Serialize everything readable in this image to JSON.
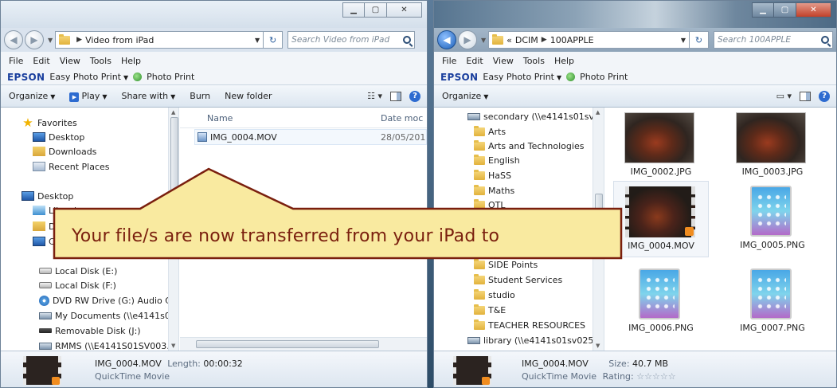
{
  "left_window": {
    "address": {
      "folder": "Video from iPad"
    },
    "search_placeholder": "Search Video from iPad",
    "menu": [
      "File",
      "Edit",
      "View",
      "Tools",
      "Help"
    ],
    "epson": {
      "brand": "EPSON",
      "easy_print": "Easy Photo Print",
      "photo_print": "Photo Print"
    },
    "toolbar": {
      "organize": "Organize",
      "play": "Play",
      "share": "Share with",
      "burn": "Burn",
      "new_folder": "New folder"
    },
    "nav": {
      "favorites": "Favorites",
      "desktop": "Desktop",
      "downloads": "Downloads",
      "recent": "Recent Places",
      "desktop2": "Desktop",
      "libraries": "Libraries",
      "d_partial": "D",
      "c_partial": "C",
      "local_e": "Local Disk (E:)",
      "local_f": "Local Disk (F:)",
      "dvd": "DVD RW Drive (G:) Audio CD",
      "mydocs": "My Documents (\\\\e4141s01sv",
      "removable": "Removable Disk (J:)",
      "rmms": "RMMS (\\\\E4141S01SV003.blue"
    },
    "columns": {
      "name": "Name",
      "date": "Date moc"
    },
    "file": {
      "name": "IMG_0004.MOV",
      "date": "28/05/201"
    },
    "details": {
      "name": "IMG_0004.MOV",
      "length_label": "Length:",
      "length": "00:00:32",
      "type": "QuickTime Movie"
    }
  },
  "right_window": {
    "address": {
      "prefix": "«",
      "parent": "DCIM",
      "folder": "100APPLE"
    },
    "search_placeholder": "Search 100APPLE",
    "menu": [
      "File",
      "Edit",
      "View",
      "Tools",
      "Help"
    ],
    "epson": {
      "brand": "EPSON",
      "easy_print": "Easy Photo Print",
      "photo_print": "Photo Print"
    },
    "toolbar": {
      "organize": "Organize"
    },
    "nav": {
      "secondary": "secondary (\\\\e4141s01sv028.b",
      "folders": [
        "Arts",
        "Arts and Technologies",
        "English",
        "HaSS",
        "Maths",
        "OTL"
      ],
      "side_points": "SIDE Points",
      "folders2": [
        "Student Services",
        "studio",
        "T&E",
        "TEACHER RESOURCES"
      ],
      "library": "library (\\\\e4141s01sv025.blue."
    },
    "tiles": [
      "IMG_0002.JPG",
      "IMG_0003.JPG",
      "IMG_0004.MOV",
      "IMG_0005.PNG",
      "IMG_0006.PNG",
      "IMG_0007.PNG"
    ],
    "details": {
      "name": "IMG_0004.MOV",
      "size_label": "Size:",
      "size": "40.7 MB",
      "type": "QuickTime Movie",
      "rating_label": "Rating:",
      "stars": "☆☆☆☆☆"
    }
  },
  "callout": {
    "text": "Your file/s are now transferred from your iPad to"
  },
  "colors": {
    "callout_fill": "#f9eaa0",
    "callout_border": "#7a1f0e"
  }
}
